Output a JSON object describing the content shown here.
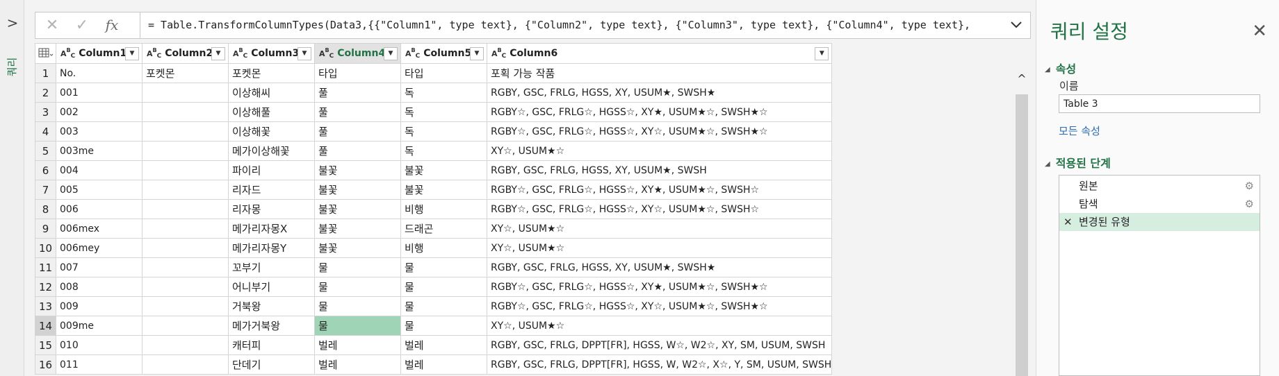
{
  "query_pane": {
    "expand_icon": "chevron-right-icon",
    "label": "쿼리"
  },
  "formula_bar": {
    "cancel_glyph": "✕",
    "confirm_glyph": "✓",
    "fx_label": "fx",
    "formula": "= Table.TransformColumnTypes(Data3,{{\"Column1\", type text}, {\"Column2\", type text}, {\"Column3\", type text}, {\"Column4\", type text},",
    "expand_glyph": "∨"
  },
  "grid": {
    "columns": [
      "Column1",
      "Column2",
      "Column3",
      "Column4",
      "Column5",
      "Column6"
    ],
    "rows": [
      [
        "1",
        "No.",
        "포켓몬",
        "포켓몬",
        "타입",
        "타입",
        "포획 가능 작품"
      ],
      [
        "2",
        "001",
        "",
        "이상해씨",
        "풀",
        "독",
        "RGBY, GSC, FRLG, HGSS, XY, USUM★, SWSH★"
      ],
      [
        "3",
        "002",
        "",
        "이상해풀",
        "풀",
        "독",
        "RGBY☆, GSC, FRLG☆, HGSS☆, XY★, USUM★☆, SWSH★☆"
      ],
      [
        "4",
        "003",
        "",
        "이상해꽃",
        "풀",
        "독",
        "RGBY☆, GSC, FRLG☆, HGSS☆, XY☆, USUM★☆, SWSH★☆"
      ],
      [
        "5",
        "003me",
        "",
        "메가이상해꽃",
        "풀",
        "독",
        "XY☆, USUM★☆"
      ],
      [
        "6",
        "004",
        "",
        "파이리",
        "불꽃",
        "불꽃",
        "RGBY, GSC, FRLG, HGSS, XY, USUM★, SWSH"
      ],
      [
        "7",
        "005",
        "",
        "리자드",
        "불꽃",
        "불꽃",
        "RGBY☆, GSC, FRLG☆, HGSS☆, XY★, USUM★☆, SWSH☆"
      ],
      [
        "8",
        "006",
        "",
        "리자몽",
        "불꽃",
        "비행",
        "RGBY☆, GSC, FRLG☆, HGSS☆, XY☆, USUM★☆, SWSH☆"
      ],
      [
        "9",
        "006mex",
        "",
        "메가리자몽X",
        "불꽃",
        "드래곤",
        "XY☆, USUM★☆"
      ],
      [
        "10",
        "006mey",
        "",
        "메가리자몽Y",
        "불꽃",
        "비행",
        "XY☆, USUM★☆"
      ],
      [
        "11",
        "007",
        "",
        "꼬부기",
        "물",
        "물",
        "RGBY, GSC, FRLG, HGSS, XY, USUM★, SWSH★"
      ],
      [
        "12",
        "008",
        "",
        "어니부기",
        "물",
        "물",
        "RGBY☆, GSC, FRLG☆, HGSS☆, XY★, USUM★☆, SWSH★☆"
      ],
      [
        "13",
        "009",
        "",
        "거북왕",
        "물",
        "물",
        "RGBY☆, GSC, FRLG☆, HGSS☆, XY☆, USUM★☆, SWSH★☆"
      ],
      [
        "14",
        "009me",
        "",
        "메가거북왕",
        "물",
        "물",
        "XY☆, USUM★☆"
      ],
      [
        "15",
        "010",
        "",
        "캐터피",
        "벌레",
        "벌레",
        "RGBY, GSC, FRLG, DPPT[FR], HGSS, W☆, W2☆, XY, SM, USUM, SWSH"
      ],
      [
        "16",
        "011",
        "",
        "단데기",
        "벌레",
        "벌레",
        "RGBY, GSC, FRLG, DPPT[FR], HGSS, W, W2☆, X☆, Y, SM, USUM, SWSH"
      ]
    ],
    "selected_row": 14,
    "selected_col": 4,
    "type_icon_text": "ABC"
  },
  "query_settings": {
    "title": "쿼리 설정",
    "close_glyph": "✕",
    "properties_header": "속성",
    "name_label": "이름",
    "name_value": "Table 3",
    "all_properties_link": "모든 속성",
    "applied_steps_header": "적용된 단계",
    "steps": [
      {
        "label": "원본",
        "has_gear": true,
        "active": false
      },
      {
        "label": "탐색",
        "has_gear": true,
        "active": false
      },
      {
        "label": "변경된 유형",
        "has_gear": false,
        "active": true
      }
    ],
    "colors": {
      "accent": "#217346",
      "selection": "#9fd5b6",
      "link": "#2c6bb5"
    }
  }
}
